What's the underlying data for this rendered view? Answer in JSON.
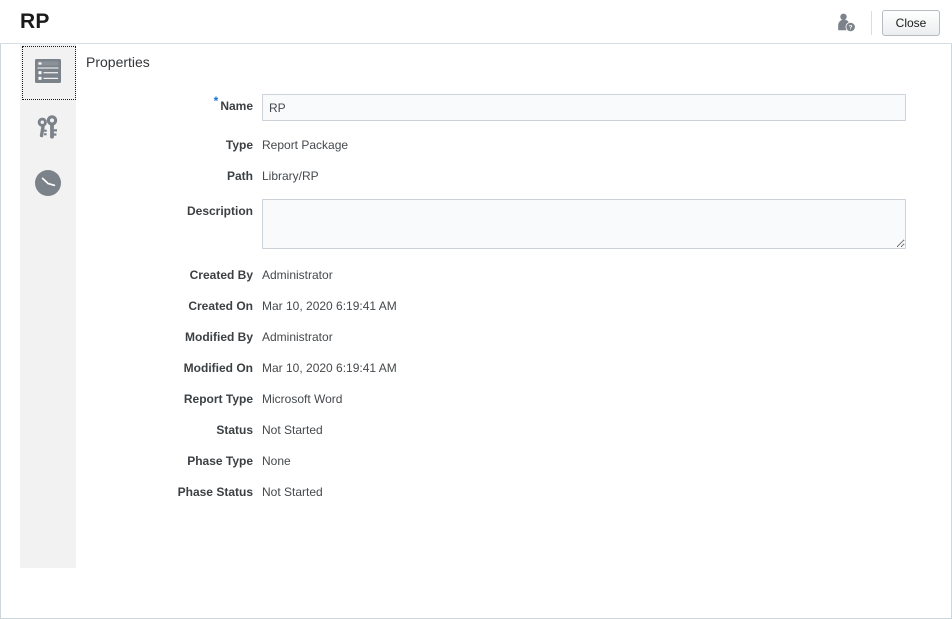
{
  "header": {
    "title": "RP",
    "user_icon": "user-restricted-icon",
    "close_label": "Close"
  },
  "rail": {
    "items": [
      {
        "icon": "properties-list-icon",
        "name": "properties",
        "selected": true
      },
      {
        "icon": "keys-icon",
        "name": "access",
        "selected": false
      },
      {
        "icon": "clock-history-icon",
        "name": "history",
        "selected": false
      }
    ]
  },
  "main": {
    "panel_title": "Properties",
    "fields": {
      "name": {
        "label": "Name",
        "required_marker": "*",
        "value": "RP",
        "placeholder": ""
      },
      "type": {
        "label": "Type",
        "value": "Report Package"
      },
      "path": {
        "label": "Path",
        "value": "Library/RP"
      },
      "description": {
        "label": "Description",
        "value": "",
        "placeholder": ""
      },
      "created_by": {
        "label": "Created By",
        "value": "Administrator"
      },
      "created_on": {
        "label": "Created On",
        "value": "Mar 10, 2020 6:19:41 AM"
      },
      "modified_by": {
        "label": "Modified By",
        "value": "Administrator"
      },
      "modified_on": {
        "label": "Modified On",
        "value": "Mar 10, 2020 6:19:41 AM"
      },
      "report_type": {
        "label": "Report Type",
        "value": "Microsoft Word"
      },
      "status": {
        "label": "Status",
        "value": "Not Started"
      },
      "phase_type": {
        "label": "Phase Type",
        "value": "None"
      },
      "phase_status": {
        "label": "Phase Status",
        "value": "Not Started"
      }
    }
  },
  "colors": {
    "rail_background": "#f2f2f2",
    "icon_gray": "#7b828a",
    "required_blue": "#1a73c8",
    "border": "#ccd6dd",
    "field_background": "#f9fafb"
  }
}
